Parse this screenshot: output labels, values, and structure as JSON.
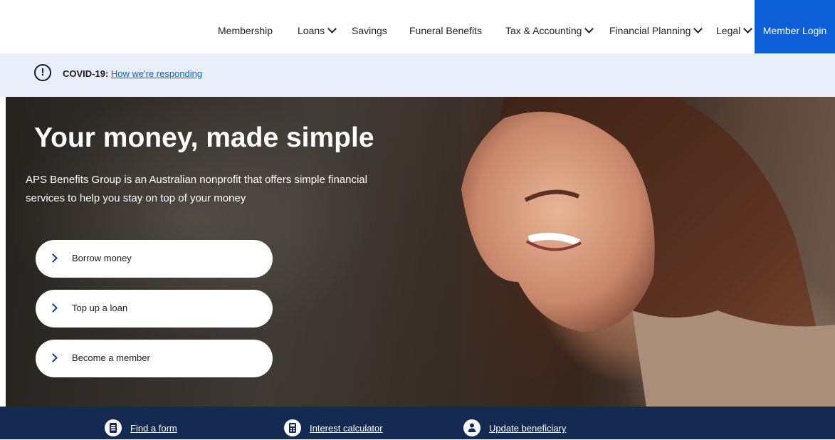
{
  "nav": {
    "items": [
      {
        "label": "Membership"
      },
      {
        "label": "Loans"
      },
      {
        "label": "Savings"
      },
      {
        "label": "Funeral Benefits"
      },
      {
        "label": "Tax & Accounting"
      },
      {
        "label": "Financial Planning"
      },
      {
        "label": "Legal"
      }
    ],
    "login_label": "Member Login"
  },
  "alert": {
    "prefix": "COVID-19:",
    "link_text": "How we're responding"
  },
  "hero": {
    "title": "Your money, made simple",
    "subtitle": "APS Benefits Group is an Australian nonprofit that offers simple financial services to help you stay on top of your money",
    "buttons": [
      {
        "label": "Borrow money"
      },
      {
        "label": "Top up a loan"
      },
      {
        "label": "Become a member"
      }
    ]
  },
  "quick_links": [
    {
      "label": "Find a form",
      "icon": "form-icon"
    },
    {
      "label": "Interest calculator",
      "icon": "calculator-icon"
    },
    {
      "label": "Update beneficiary",
      "icon": "person-icon"
    }
  ],
  "colors": {
    "accent": "#0c5fd6",
    "alert_bg": "#e9effa",
    "footer_bar": "#142a52"
  }
}
